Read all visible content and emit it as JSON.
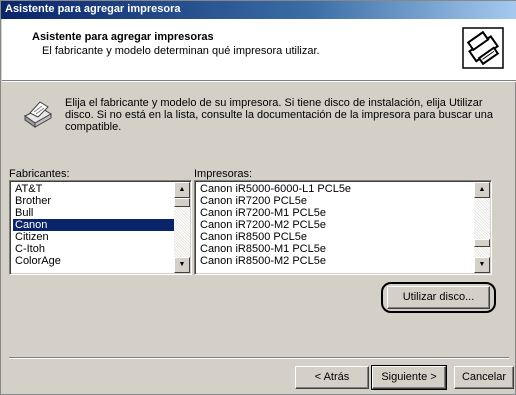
{
  "window": {
    "title": "Asistente para agregar impresora"
  },
  "header": {
    "title": "Asistente para agregar impresoras",
    "subtitle": "El fabricante y modelo determinan qué impresora utilizar.",
    "icon": "printer-wizard-icon"
  },
  "intro": {
    "icon": "printer-icon",
    "text": "Elija el fabricante y modelo de su impresora. Si tiene disco de instalación, elija Utilizar disco. Si no está en la lista, consulte la documentación de la impresora para buscar una compatible."
  },
  "manufacturers": {
    "label": "Fabricantes:",
    "items": [
      "AT&T",
      "Brother",
      "Bull",
      "Canon",
      "Citizen",
      "C-Itoh",
      "ColorAge"
    ],
    "selected": "Canon"
  },
  "printers": {
    "label": "Impresoras:",
    "items": [
      "Canon iR5000-6000-L1 PCL5e",
      "Canon iR7200 PCL5e",
      "Canon iR7200-M1 PCL5e",
      "Canon iR7200-M2 PCL5e",
      "Canon iR8500 PCL5e",
      "Canon iR8500-M1 PCL5e",
      "Canon iR8500-M2 PCL5e"
    ]
  },
  "buttons": {
    "have_disk": "Utilizar disco...",
    "back": "< Atrás",
    "next": "Siguiente >",
    "cancel": "Cancelar"
  },
  "colors": {
    "title_gradient_start": "#0a246a",
    "title_gradient_end": "#a6caf0",
    "selection": "#0a246a",
    "dialog_bg": "#d4d0c8"
  }
}
